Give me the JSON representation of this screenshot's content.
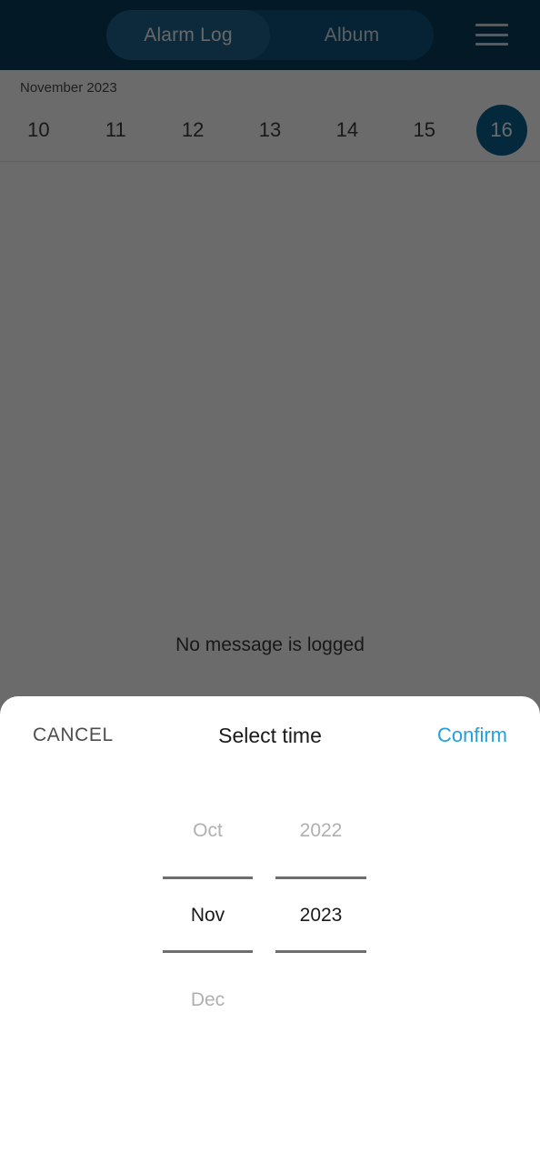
{
  "topbar": {
    "tabs": [
      {
        "label": "Alarm Log",
        "selected": true
      },
      {
        "label": "Album",
        "selected": false
      }
    ],
    "menu_icon": "hamburger-menu-icon",
    "background_color": "#0a3d5c"
  },
  "date_strip": {
    "month_label": "November 2023",
    "days": [
      {
        "label": "10",
        "selected": false
      },
      {
        "label": "11",
        "selected": false
      },
      {
        "label": "12",
        "selected": false
      },
      {
        "label": "13",
        "selected": false
      },
      {
        "label": "14",
        "selected": false
      },
      {
        "label": "15",
        "selected": false
      },
      {
        "label": "16",
        "selected": true
      }
    ],
    "selected_color": "#0a6391"
  },
  "content": {
    "empty_message": "No message is logged"
  },
  "sheet": {
    "cancel_label": "CANCEL",
    "title": "Select time",
    "confirm_label": "Confirm",
    "confirm_color": "#22a0de",
    "picker": {
      "month": {
        "previous": "Oct",
        "selected": "Nov",
        "next": "Dec"
      },
      "year": {
        "previous": "2022",
        "selected": "2023",
        "next": ""
      }
    }
  }
}
